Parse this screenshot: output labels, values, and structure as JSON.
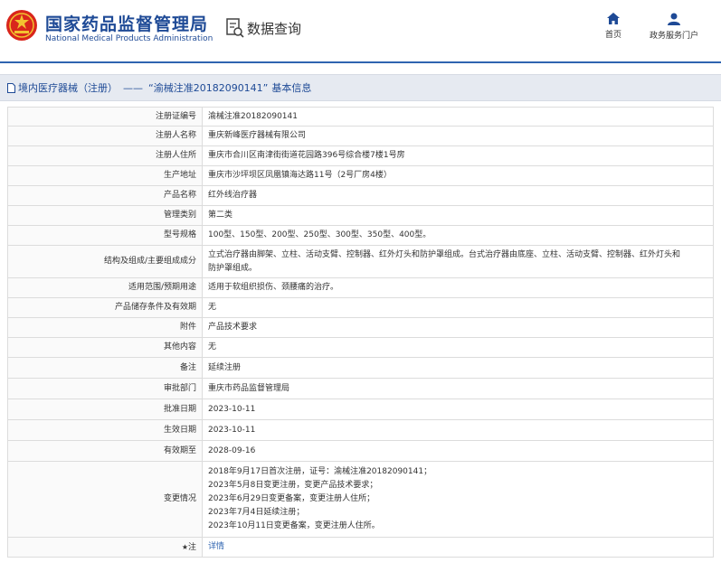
{
  "header": {
    "brand_cn": "国家药品监督管理局",
    "brand_en": "National Medical Products Administration",
    "query_label": "数据查询",
    "nav": [
      {
        "label": "首页",
        "icon": "home-icon"
      },
      {
        "label": "政务服务门户",
        "icon": "user-icon"
      }
    ]
  },
  "titlebar": {
    "category": "境内医疗器械（注册）",
    "separator": "——",
    "record": "“渝械注准20182090141”",
    "suffix": "基本信息"
  },
  "rows": [
    {
      "label": "注册证编号",
      "value": "渝械注准20182090141"
    },
    {
      "label": "注册人名称",
      "value": "重庆新峰医疗器械有限公司"
    },
    {
      "label": "注册人住所",
      "value": "重庆市合川区南津街街道花园路396号综合楼7楼1号房"
    },
    {
      "label": "生产地址",
      "value": "重庆市沙坪坝区凤凰镇海达路11号（2号厂房4楼）"
    },
    {
      "label": "产品名称",
      "value": "红外线治疗器"
    },
    {
      "label": "管理类别",
      "value": "第二类"
    },
    {
      "label": "型号规格",
      "value": "100型、150型、200型、250型、300型、350型、400型。"
    },
    {
      "label": "结构及组成/主要组成成分",
      "value_lines": [
        "立式治疗器由脚架、立柱、活动支臂、控制器、红外灯头和防护罩组成。台式治疗器由底座、立柱、活动支臂、控制器、红外灯头和",
        "防护罩组成。"
      ]
    },
    {
      "label": "适用范围/预期用途",
      "value": "适用于软组织损伤、颈腰痛的治疗。"
    },
    {
      "label": "产品储存条件及有效期",
      "value": "无"
    },
    {
      "label": "附件",
      "value": "产品技术要求"
    },
    {
      "label": "其他内容",
      "value": "无"
    },
    {
      "label": "备注",
      "value": "延续注册"
    },
    {
      "label": "审批部门",
      "value": "重庆市药品监督管理局"
    },
    {
      "label": "批准日期",
      "value": "2023-10-11"
    },
    {
      "label": "生效日期",
      "value": "2023-10-11"
    },
    {
      "label": "有效期至",
      "value": "2028-09-16"
    },
    {
      "label": "变更情况",
      "value_lines": [
        "2018年9月17日首次注册，证号：渝械注准20182090141；",
        "2023年5月8日变更注册，变更产品技术要求；",
        "2023年6月29日变更备案，变更注册人住所；",
        "2023年7月4日延续注册；",
        "2023年10月11日变更备案，变更注册人住所。"
      ]
    },
    {
      "label": "注",
      "label_icon": "star-icon",
      "value": "详情",
      "value_is_link": true
    }
  ],
  "colors": {
    "brand_blue": "#1e4a96",
    "accent_blue": "#2f64b0",
    "emblem_red": "#d9261c",
    "emblem_gold": "#f2c230"
  }
}
